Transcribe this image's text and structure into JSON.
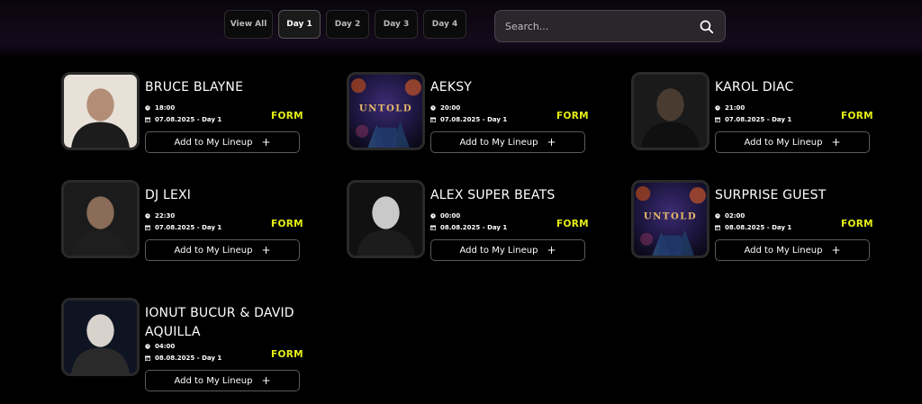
{
  "filters": {
    "view_all": "View All",
    "day1": "Day 1",
    "day2": "Day 2",
    "day3": "Day 3",
    "day4": "Day 4",
    "active": "Day 1"
  },
  "search": {
    "placeholder": "Search...",
    "value": ""
  },
  "icons": {
    "search": "search-icon",
    "time": "clock-icon",
    "date": "calendar-icon",
    "add": "plus-icon"
  },
  "colors": {
    "accent": "#e6f014",
    "background": "#000000"
  },
  "artists": [
    {
      "name": "BRUCE BLAYNE",
      "time": "18:00",
      "date": "07.08.2025 - Day 1",
      "stage": "FORM",
      "button": "Add to My Lineup",
      "photo": "portrait"
    },
    {
      "name": "AEKSY",
      "time": "20:00",
      "date": "07.08.2025 - Day 1",
      "stage": "FORM",
      "button": "Add to My Lineup",
      "photo": "untold-logo",
      "logo_text": "UNTOLD"
    },
    {
      "name": "KAROL DIAC",
      "time": "21:00",
      "date": "07.08.2025 - Day 1",
      "stage": "FORM",
      "button": "Add to My Lineup",
      "photo": "portrait"
    },
    {
      "name": "DJ LEXI",
      "time": "22:30",
      "date": "07.08.2025 - Day 1",
      "stage": "FORM",
      "button": "Add to My Lineup",
      "photo": "portrait"
    },
    {
      "name": "ALEX SUPER BEATS",
      "time": "00:00",
      "date": "08.08.2025 - Day 1",
      "stage": "FORM",
      "button": "Add to My Lineup",
      "photo": "portrait"
    },
    {
      "name": "SURPRISE GUEST",
      "time": "02:00",
      "date": "08.08.2025 - Day 1",
      "stage": "FORM",
      "button": "Add to My Lineup",
      "photo": "untold-logo",
      "logo_text": "UNTOLD"
    },
    {
      "name": "IONUT BUCUR & DAVID AQUILLA",
      "time": "04:00",
      "date": "08.08.2025 - Day 1",
      "stage": "FORM",
      "button": "Add to My Lineup",
      "photo": "portrait"
    }
  ]
}
